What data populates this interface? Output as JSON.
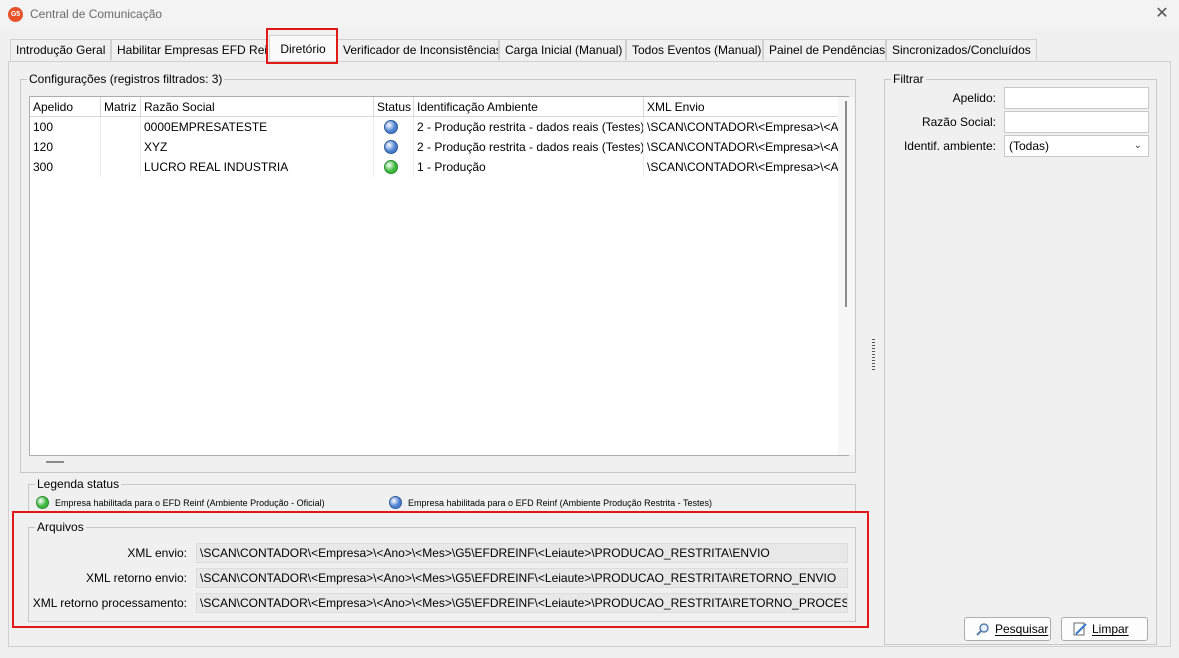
{
  "window": {
    "app_icon_text": "G5",
    "title": "Central de Comunicação",
    "close_symbol": "✕"
  },
  "tabs": [
    {
      "label": "Introdução Geral",
      "active": false
    },
    {
      "label": "Habilitar Empresas EFD Reinf",
      "active": false
    },
    {
      "label": "Diretório",
      "active": true
    },
    {
      "label": "Verificador de Inconsistências",
      "active": false
    },
    {
      "label": "Carga Inicial (Manual)",
      "active": false
    },
    {
      "label": "Todos Eventos (Manual)",
      "active": false
    },
    {
      "label": "Painel de Pendências",
      "active": false
    },
    {
      "label": "Sincronizados/Concluídos",
      "active": false
    }
  ],
  "configuracoes": {
    "title": "Configurações (registros filtrados: 3)",
    "columns": [
      "Apelido",
      "Matriz",
      "Razão Social",
      "Status",
      "Identificação Ambiente",
      "XML Envio"
    ],
    "rows": [
      {
        "apelido": "100",
        "matriz": "",
        "razao_social": "0000EMPRESATESTE",
        "status": "blue",
        "ambiente": "2 - Produção restrita - dados reais (Testes)",
        "xml_envio": "\\SCAN\\CONTADOR\\<Empresa>\\<A"
      },
      {
        "apelido": "120",
        "matriz": "",
        "razao_social": "XYZ",
        "status": "blue",
        "ambiente": "2 - Produção restrita - dados reais (Testes)",
        "xml_envio": "\\SCAN\\CONTADOR\\<Empresa>\\<A"
      },
      {
        "apelido": "300",
        "matriz": "",
        "razao_social": "LUCRO REAL INDUSTRIA",
        "status": "green",
        "ambiente": "1 - Produção",
        "xml_envio": "\\SCAN\\CONTADOR\\<Empresa>\\<A"
      }
    ]
  },
  "legenda": {
    "title": "Legenda status",
    "items": [
      {
        "color": "green",
        "label": "Empresa habilitada para o EFD Reinf (Ambiente Produção - Oficial)"
      },
      {
        "color": "blue",
        "label": "Empresa habilitada para o EFD Reinf (Ambiente Produção Restrita - Testes)"
      }
    ]
  },
  "arquivos": {
    "title": "Arquivos",
    "fields": [
      {
        "label": "XML envio:",
        "value": "\\SCAN\\CONTADOR\\<Empresa>\\<Ano>\\<Mes>\\G5\\EFDREINF\\<Leiaute>\\PRODUCAO_RESTRITA\\ENVIO"
      },
      {
        "label": "XML retorno envio:",
        "value": "\\SCAN\\CONTADOR\\<Empresa>\\<Ano>\\<Mes>\\G5\\EFDREINF\\<Leiaute>\\PRODUCAO_RESTRITA\\RETORNO_ENVIO"
      },
      {
        "label": "XML retorno processamento:",
        "value": "\\SCAN\\CONTADOR\\<Empresa>\\<Ano>\\<Mes>\\G5\\EFDREINF\\<Leiaute>\\PRODUCAO_RESTRITA\\RETORNO_PROCESSAMENTO"
      }
    ]
  },
  "filtrar": {
    "title": "Filtrar",
    "apelido_label": "Apelido:",
    "apelido_value": "",
    "razao_label": "Razão Social:",
    "razao_value": "",
    "ambiente_label": "Identif. ambiente:",
    "ambiente_value": "(Todas)",
    "pesquisar_label": "Pesquisar",
    "limpar_label": "Limpar"
  },
  "colors": {
    "highlight_red": "#e01818",
    "status_blue": "#4a7fd0",
    "status_green": "#3cb83c"
  }
}
